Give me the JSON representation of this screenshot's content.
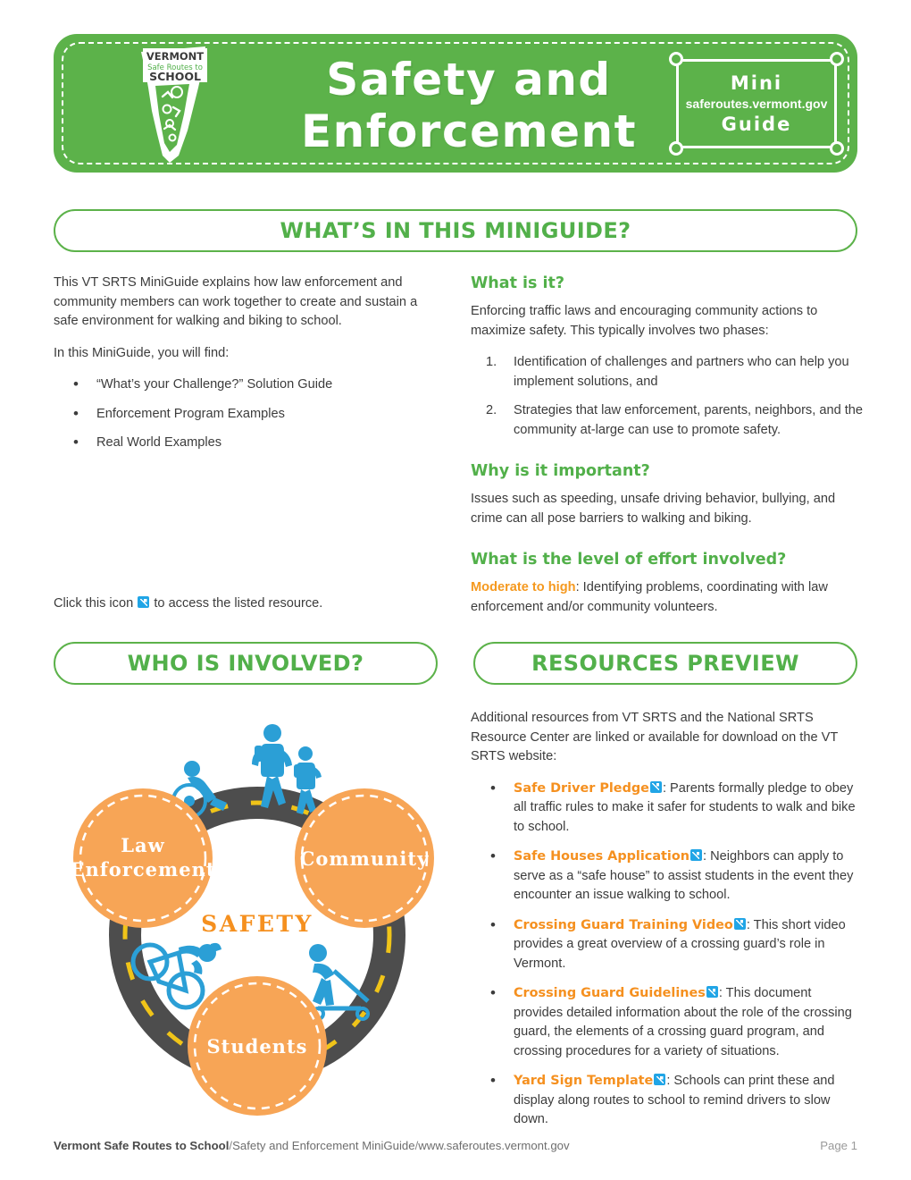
{
  "header": {
    "logo_alt": "vermont-safe-routes-to-school-logo",
    "logo_line1": "VERMONT",
    "logo_line2": "Safe Routes to",
    "logo_line3": "SCHOOL",
    "title_line1": "Safety and",
    "title_line2": "Enforcement",
    "badge_top": "Mini",
    "badge_url": "saferoutes.vermont.gov",
    "badge_bottom": "Guide"
  },
  "sections": {
    "whats_in_this": "WHAT’S IN THIS MINIGUIDE?",
    "who_is_involved": "WHO IS INVOLVED?",
    "resources_preview": "RESOURCES PREVIEW"
  },
  "left_column": {
    "intro": "This VT SRTS MiniGuide explains how law enforcement and community members can work together to create and sustain a safe environment for walking and biking to school.",
    "find_lead": "In this MiniGuide, you will find:",
    "find_items": [
      "“What’s your Challenge?” Solution Guide",
      "Enforcement Program Examples",
      "Real World Examples"
    ],
    "click_note_before": "Click this icon",
    "click_note_after": "to access the listed resource."
  },
  "right_column": {
    "what_is_it_heading": "What is it?",
    "what_is_it_body": "Enforcing traffic laws and encouraging community actions to maximize safety. This typically involves two phases:",
    "what_is_it_steps": [
      "Identification of challenges and partners who can help you implement solutions, and",
      "Strategies that law enforcement, parents, neighbors, and the community at-large can use to promote safety."
    ],
    "why_heading": "Why is it important?",
    "why_body": "Issues such as speeding, unsafe driving behavior, bullying, and crime can all pose barriers to walking and biking.",
    "effort_heading": "What is the level of effort involved?",
    "effort_level": "Moderate to high",
    "effort_body": ": Identifying problems, coordinating with law enforcement and/or community volunteers."
  },
  "resources": {
    "intro": "Additional resources from VT SRTS and the National SRTS Resource Center are linked or available for download on the VT SRTS website:",
    "items": [
      {
        "title": "Safe Driver Pledge",
        "description": ": Parents formally pledge to obey all traffic rules to make it safer for students to walk and bike to school."
      },
      {
        "title": "Safe Houses Application",
        "description": ": Neighbors can apply to serve as a “safe house” to assist students in the event they encounter an issue walking to school."
      },
      {
        "title": "Crossing Guard Training Video",
        "description": ": This short video provides a great overview of a crossing guard’s role in Vermont."
      },
      {
        "title": "Crossing Guard Guidelines",
        "description": ": This document provides detailed information about the role of the crossing guard, the elements of a crossing guard program, and crossing procedures for a variety of situations."
      },
      {
        "title": "Yard Sign Template",
        "description": ": Schools can print these and display along routes to school to remind drivers to slow down."
      }
    ]
  },
  "diagram": {
    "center_label": "SAFETY",
    "nodes": [
      {
        "id": "law-enforcement",
        "line1": "Law",
        "line2": "Enforcement"
      },
      {
        "id": "community",
        "line1": "Community",
        "line2": ""
      },
      {
        "id": "students",
        "line1": "Students",
        "line2": ""
      }
    ],
    "figures": [
      "wheelchair-user-icon",
      "adult-walking-icon",
      "child-walking-icon",
      "cyclist-icon",
      "scooter-rider-icon"
    ]
  },
  "footer": {
    "org": "Vermont Safe Routes to School",
    "separator1": " / ",
    "doc": "Safety and Enforcement MiniGuide",
    "separator2": " / ",
    "url": "www.saferoutes.vermont.gov",
    "page": "Page 1"
  },
  "colors": {
    "green": "#5cb24a",
    "orange": "#f7a556",
    "orange_text": "#f5901f",
    "blue": "#2b9fd6",
    "road": "#4d4d4d",
    "road_dash": "#f0c419"
  }
}
